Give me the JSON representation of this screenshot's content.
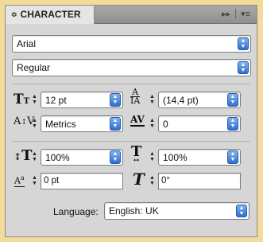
{
  "panel": {
    "title": "CHARACTER",
    "tab_arrow": "≎",
    "menu_controls": "▸▸"
  },
  "font": {
    "family": "Arial",
    "style": "Regular"
  },
  "metrics": {
    "font_size": "12 pt",
    "leading": "(14,4 pt)",
    "kerning": "Metrics",
    "tracking": "0",
    "vertical_scale": "100%",
    "horizontal_scale": "100%",
    "baseline_shift": "0 pt",
    "skew": "0°"
  },
  "language": {
    "label": "Language:",
    "value": "English: UK"
  },
  "icons": [
    "font-size-icon",
    "leading-icon",
    "kerning-icon",
    "tracking-icon",
    "vertical-scale-icon",
    "horizontal-scale-icon",
    "baseline-shift-icon",
    "skew-icon",
    "panel-menu-icon",
    "collapse-icon"
  ]
}
